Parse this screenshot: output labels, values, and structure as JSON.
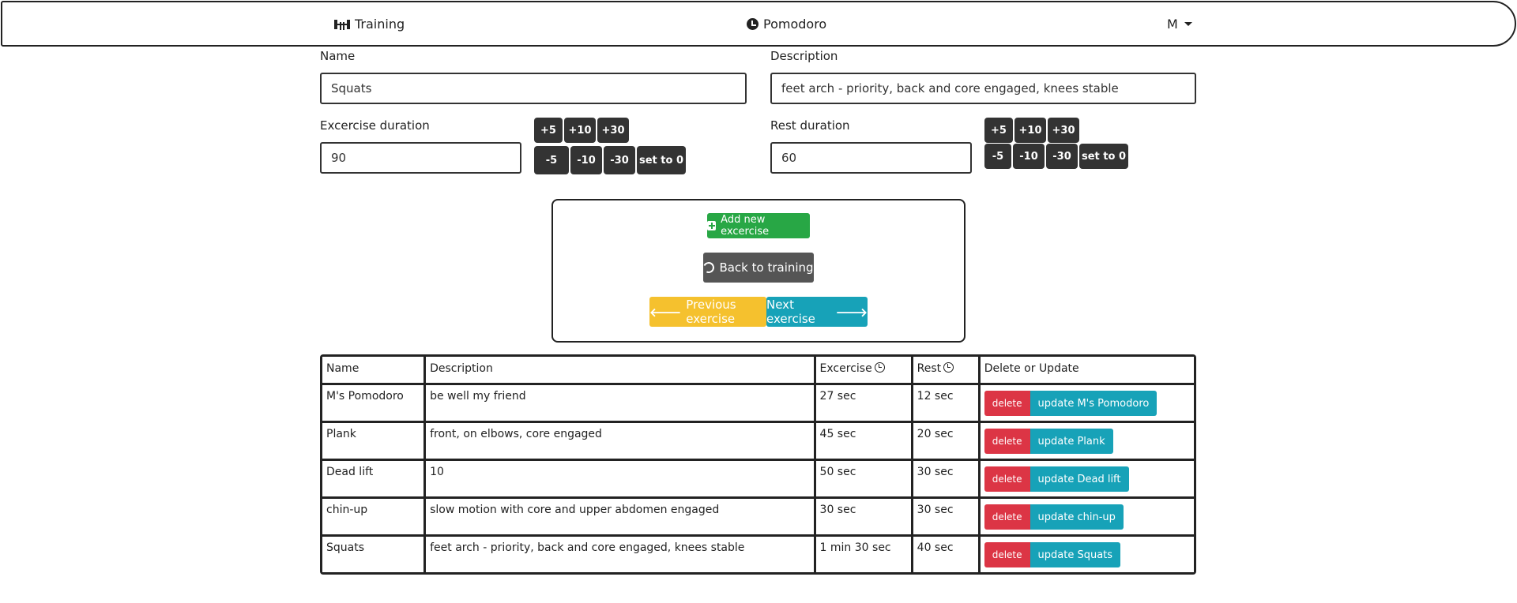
{
  "nav": {
    "training_label": "Training",
    "pomodoro_label": "Pomodoro",
    "user_label": "M"
  },
  "form": {
    "name_label": "Name",
    "name_value": "Squats",
    "description_label": "Description",
    "description_value": "feet arch - priority, back and core engaged, knees stable",
    "exercise_duration_label": "Excercise duration",
    "exercise_duration_value": "90",
    "rest_duration_label": "Rest duration",
    "rest_duration_value": "60",
    "inc_buttons": [
      "+5",
      "+10",
      "+30"
    ],
    "dec_buttons": [
      "-5",
      "-10",
      "-30"
    ],
    "reset_label": "set to 0"
  },
  "actions": {
    "add_label": "Add new excercise",
    "back_label": "Back to training",
    "prev_label": "Previous exercise",
    "next_label": "Next exercise"
  },
  "table": {
    "headers": [
      "Name",
      "Description",
      "Excercise",
      "Rest",
      "Delete or Update"
    ],
    "delete_label": "delete",
    "rows": [
      {
        "name": "M's Pomodoro",
        "description": "be well my friend",
        "exercise": "27 sec",
        "rest": "12 sec",
        "update": "update M's Pomodoro"
      },
      {
        "name": "Plank",
        "description": "front, on elbows, core engaged",
        "exercise": "45 sec",
        "rest": "20 sec",
        "update": "update Plank"
      },
      {
        "name": "Dead lift",
        "description": "10",
        "exercise": "50 sec",
        "rest": "30 sec",
        "update": "update Dead lift"
      },
      {
        "name": "chin-up",
        "description": "slow motion with core and upper abdomen engaged",
        "exercise": "30 sec",
        "rest": "30 sec",
        "update": "update chin-up"
      },
      {
        "name": "Squats",
        "description": "feet arch - priority, back and core engaged, knees stable",
        "exercise": "1 min 30 sec",
        "rest": "40 sec",
        "update": "update Squats"
      }
    ]
  },
  "colors": {
    "green": "#28a745",
    "dark": "#333333",
    "yellow": "#f5c12e",
    "teal": "#17a2b8",
    "red": "#dc3545"
  }
}
